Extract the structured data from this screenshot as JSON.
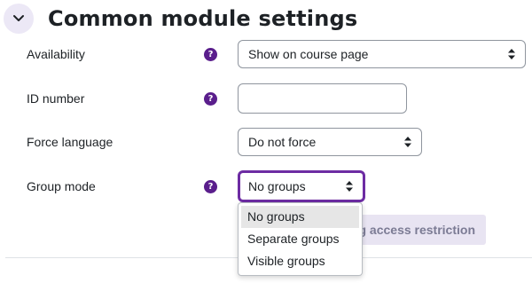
{
  "section": {
    "title": "Common module settings",
    "collapse_icon": "chevron-down-icon"
  },
  "fields": {
    "availability": {
      "label": "Availability",
      "value": "Show on course page",
      "help_glyph": "?"
    },
    "id_number": {
      "label": "ID number",
      "value": "",
      "help_glyph": "?"
    },
    "force_language": {
      "label": "Force language",
      "value": "Do not force"
    },
    "group_mode": {
      "label": "Group mode",
      "value": "No groups",
      "help_glyph": "?",
      "options": [
        "No groups",
        "Separate groups",
        "Visible groups"
      ]
    }
  },
  "access_restriction_button": {
    "label": "g access restriction"
  },
  "colors": {
    "accent": "#6d2ca3",
    "help_icon": "#5a1e8c",
    "collapse_bg": "#ece8f6",
    "button_bg": "#e8e4f2"
  }
}
